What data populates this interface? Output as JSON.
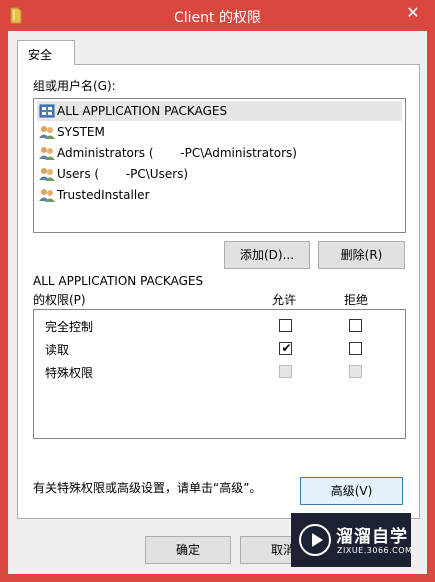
{
  "window": {
    "title": "Client 的权限",
    "close_glyph": "✕"
  },
  "tabs": [
    {
      "label": "安全"
    }
  ],
  "group": {
    "label": "组或用户名(G):",
    "items": [
      {
        "label": "ALL APPLICATION PACKAGES",
        "icon": "app-packages-icon",
        "selected": true
      },
      {
        "label": "SYSTEM",
        "icon": "users-group-icon"
      },
      {
        "label": "Administrators (       -PC\\Administrators)",
        "icon": "users-group-icon"
      },
      {
        "label": "Users (       -PC\\Users)",
        "icon": "users-group-icon"
      },
      {
        "label": "TrustedInstaller",
        "icon": "users-group-icon"
      }
    ]
  },
  "buttons": {
    "add": "添加(D)...",
    "remove": "删除(R)",
    "advanced": "高级(V)",
    "ok": "确定",
    "cancel": "取消"
  },
  "permissions": {
    "subject": "ALL APPLICATION PACKAGES",
    "header": "的权限(P)",
    "allow_header": "允许",
    "deny_header": "拒绝",
    "rows": [
      {
        "name": "完全控制",
        "allow": false,
        "deny": false,
        "disabled": false
      },
      {
        "name": "读取",
        "allow": true,
        "deny": false,
        "disabled": false
      },
      {
        "name": "特殊权限",
        "allow": false,
        "deny": false,
        "disabled": true
      }
    ]
  },
  "advanced_note": "有关特殊权限或高级设置，请单击“高级”。",
  "watermark": {
    "name": "溜溜自学",
    "url": "ZIXUE.3066.COM"
  },
  "colors": {
    "titlebar": "#d9473f",
    "watermark_bg": "#1c2133"
  }
}
